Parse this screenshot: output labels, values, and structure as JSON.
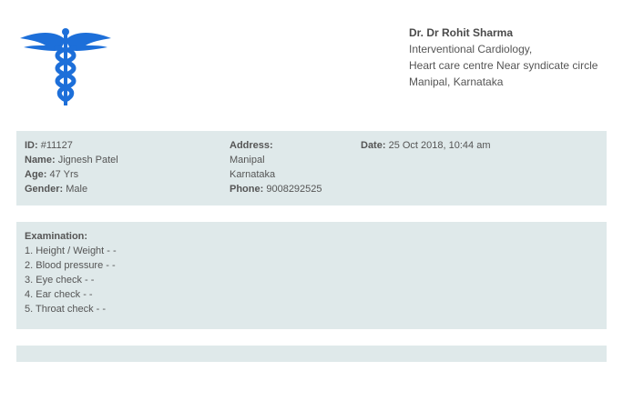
{
  "logo": {
    "icon": "caduceus-icon",
    "color": "#1d6fd9"
  },
  "doctor": {
    "name": "Dr. Dr Rohit Sharma",
    "specialty": "Interventional Cardiology,",
    "address_line": "Heart care centre Near syndicate circle",
    "location": "Manipal, Karnataka"
  },
  "patient": {
    "id_label": "ID:",
    "id_value": "#11127",
    "name_label": "Name:",
    "name_value": "Jignesh Patel",
    "age_label": "Age:",
    "age_value": "47 Yrs",
    "gender_label": "Gender:",
    "gender_value": "Male",
    "address_label": "Address:",
    "address_line1": "Manipal",
    "address_line2": "Karnataka",
    "phone_label": "Phone:",
    "phone_value": "9008292525",
    "date_label": "Date:",
    "date_value": "25 Oct 2018, 10:44 am"
  },
  "examination": {
    "heading": "Examination:",
    "items": [
      "1. Height / Weight - -",
      "2. Blood pressure - -",
      "3. Eye check - -",
      "4. Ear check - -",
      "5. Throat check - -"
    ]
  },
  "colors": {
    "panel_bg": "#dfe9ea",
    "text": "#555555"
  }
}
